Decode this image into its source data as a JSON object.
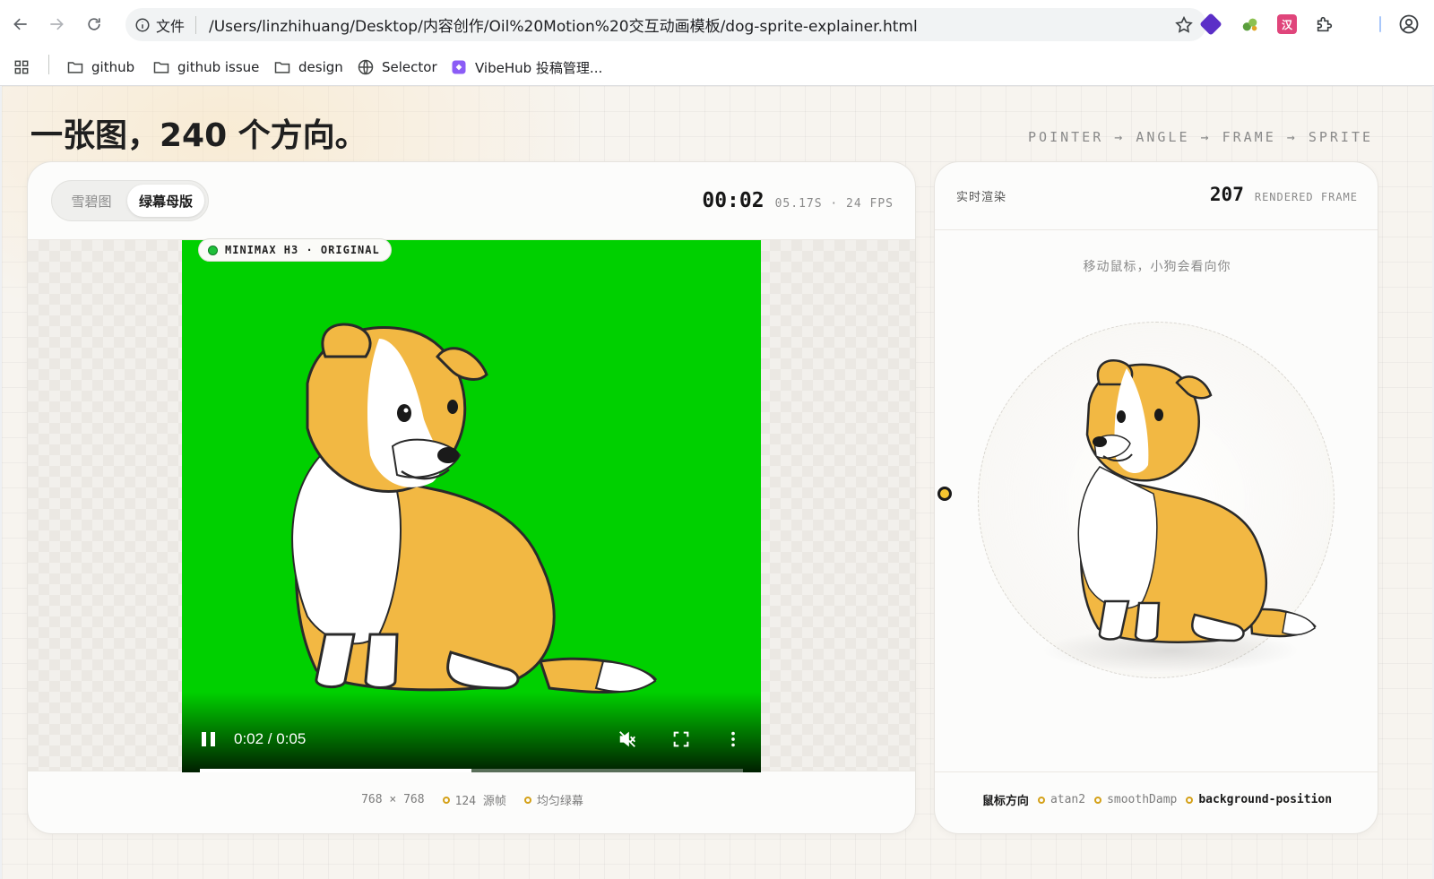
{
  "browser": {
    "omnibox": {
      "security_label": "文件",
      "url": "/Users/linzhihuang/Desktop/内容创作/Oil%20Motion%20交互动画模板/dog-sprite-explainer.html"
    },
    "bookmarks": [
      {
        "label": "github",
        "icon": "folder-icon"
      },
      {
        "label": "github issue",
        "icon": "folder-icon"
      },
      {
        "label": "design",
        "icon": "folder-icon"
      },
      {
        "label": "Selector",
        "icon": "globe-icon"
      },
      {
        "label": "VibeHub 投稿管理...",
        "icon": "vibehub-icon"
      }
    ],
    "extension_colors": {
      "ext1": "#5b2fc7",
      "ext2": "#5a9e3c",
      "ext3": "#e0457b"
    }
  },
  "page": {
    "title": "一张图，240 个方向。",
    "pipeline": "POINTER → ANGLE → FRAME → SPRITE"
  },
  "left_card": {
    "tabs": [
      {
        "label": "雪碧图",
        "active": false
      },
      {
        "label": "绿幕母版",
        "active": true
      }
    ],
    "timecode": "00:02",
    "timecode_sub": "05.17S · 24 FPS",
    "badge": "MINIMAX H3 · ORIGINAL",
    "video": {
      "time": "0:02 / 0:05",
      "progress": 0.5,
      "bg_color": "#00d000"
    },
    "meta": [
      {
        "label": "768 × 768"
      },
      {
        "label": "124 源帧"
      },
      {
        "label": "均匀绿幕"
      }
    ]
  },
  "right_card": {
    "label": "实时渲染",
    "count": "207",
    "count_unit": "RENDERED FRAME",
    "hint": "移动鼠标，小狗会看向你",
    "meta": [
      {
        "label": "鼠标方向",
        "bold": true
      },
      {
        "label": "atan2",
        "bold": false
      },
      {
        "label": "smoothDamp",
        "bold": false
      },
      {
        "label": "background-position",
        "bold": true
      }
    ]
  },
  "accent": "#d4a017"
}
